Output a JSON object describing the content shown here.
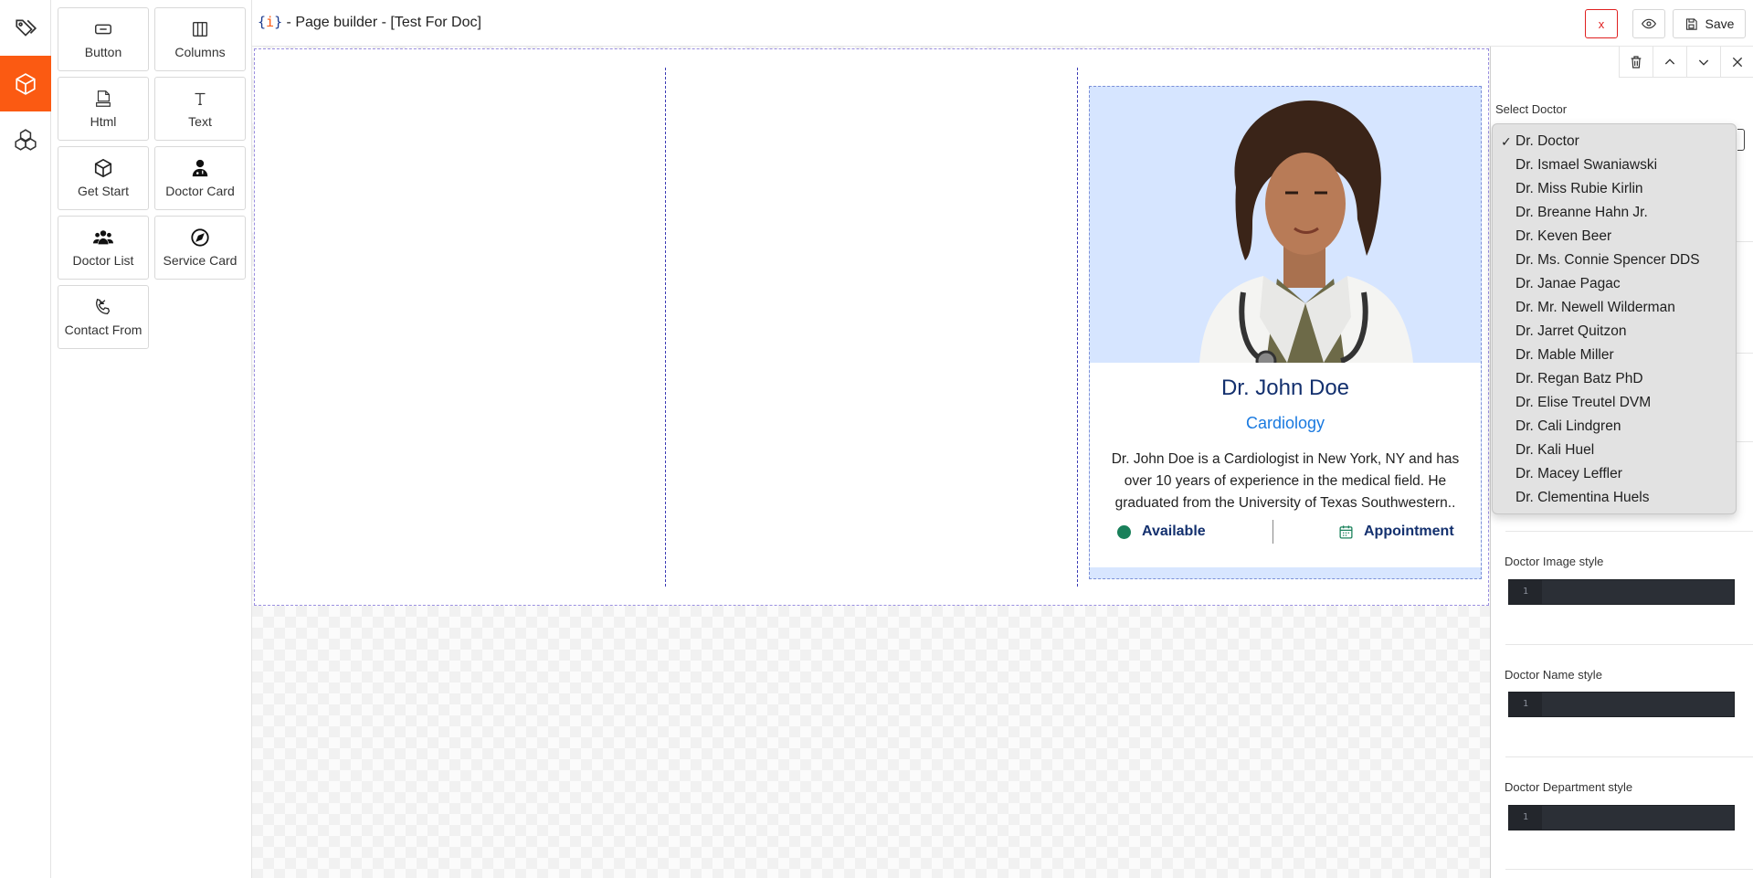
{
  "topbar": {
    "brace_open": "{",
    "brace_dot": "i",
    "brace_close": "}",
    "title": " - Page builder - [Test For Doc]",
    "close_label": "x",
    "save_label": "Save"
  },
  "blocks": [
    {
      "label": "Button",
      "icon": "button-icon"
    },
    {
      "label": "Columns",
      "icon": "columns-icon"
    },
    {
      "label": "Html",
      "icon": "html-icon"
    },
    {
      "label": "Text",
      "icon": "text-icon"
    },
    {
      "label": "Get Start",
      "icon": "cube-icon"
    },
    {
      "label": "Doctor Card",
      "icon": "doctor-icon"
    },
    {
      "label": "Doctor List",
      "icon": "users-icon"
    },
    {
      "label": "Service Card",
      "icon": "compass-icon"
    },
    {
      "label": "Contact From",
      "icon": "phone-icon"
    }
  ],
  "doctor_card": {
    "name": "Dr. John Doe",
    "department": "Cardiology",
    "description": "Dr. John Doe is a Cardiologist in New York, NY and has over 10 years of experience in the medical field. He graduated from the University of Texas Southwestern..",
    "status": "Available",
    "appointment": "Appointment"
  },
  "panel": {
    "select_doctor_label": "Select Doctor",
    "image_style_label": "Doctor Image style",
    "name_style_label": "Doctor Name style",
    "department_style_label": "Doctor Department style",
    "line_number": "1"
  },
  "dropdown": {
    "check_mark": "✓",
    "selected": "Dr. Doctor",
    "options": [
      "Dr. Doctor",
      "Dr. Ismael Swaniawski",
      "Dr. Miss Rubie Kirlin",
      "Dr. Breanne Hahn Jr.",
      "Dr. Keven Beer",
      "Dr. Ms. Connie Spencer DDS",
      "Dr. Janae Pagac",
      "Dr. Mr. Newell Wilderman",
      "Dr. Jarret Quitzon",
      "Dr. Mable Miller",
      "Dr. Regan Batz PhD",
      "Dr. Elise Treutel DVM",
      "Dr. Cali Lindgren",
      "Dr. Kali Huel",
      "Dr. Macey Leffler",
      "Dr. Clementina Huels"
    ]
  },
  "colors": {
    "accent": "#fb5a12",
    "doctor_name": "#13306e",
    "department": "#1a7ae0",
    "status_dot": "#19805a"
  }
}
